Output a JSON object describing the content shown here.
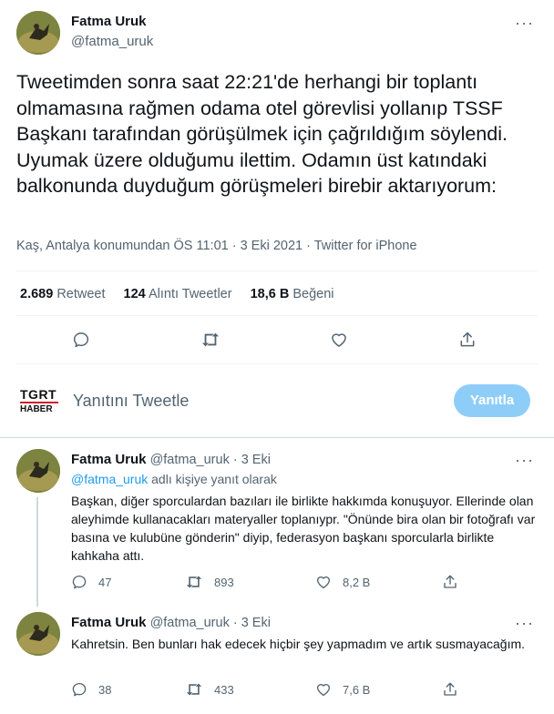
{
  "main_tweet": {
    "author_name": "Fatma Uruk",
    "author_handle": "@fatma_uruk",
    "more_label": "···",
    "text": "Tweetimden sonra saat 22:21'de herhangi bir toplantı olmamasına rağmen odama otel görevlisi yollanıp TSSF Başkanı tarafından görüşülmek için çağrıldığım söylendi. Uyumak üzere olduğumu ilettim. Odamın üst katındaki balkonunda duyduğum görüşmeleri birebir aktarıyorum:",
    "meta": "Kaş, Antalya konumundan ÖS 11:01 · 3 Eki 2021 · Twitter for iPhone",
    "stats": {
      "retweets_count": "2.689",
      "retweets_label": "Retweet",
      "quotes_count": "124",
      "quotes_label": "Alıntı Tweetler",
      "likes_count": "18,6 B",
      "likes_label": "Beğeni"
    }
  },
  "composer": {
    "logo_top": "TGRT",
    "logo_bottom": "HABER",
    "placeholder": "Yanıtını Tweetle",
    "button_label": "Yanıtla"
  },
  "replies": [
    {
      "author_name": "Fatma Uruk",
      "author_handle": "@fatma_uruk",
      "date": "· 3 Eki",
      "more_label": "···",
      "reply_to_handle": "@fatma_uruk",
      "reply_to_suffix": "adlı kişiye yanıt olarak",
      "text": "Başkan, diğer sporculardan bazıları ile birlikte hakkımda konuşuyor. Ellerinde olan aleyhimde kullanacakları materyaller toplanıypr. \"Önünde bira olan bir fotoğrafı var basına ve kulubüne gönderin\" diyip, federasyon başkanı sporcularla birlikte kahkaha attı.",
      "replies_count": "47",
      "retweets_count": "893",
      "likes_count": "8,2 B"
    },
    {
      "author_name": "Fatma Uruk",
      "author_handle": "@fatma_uruk",
      "date": "· 3 Eki",
      "more_label": "···",
      "text": "Kahretsin. Ben bunları hak edecek hiçbir şey yapmadım ve artık susmayacağım.",
      "replies_count": "38",
      "retweets_count": "433",
      "likes_count": "7,6 B"
    }
  ]
}
